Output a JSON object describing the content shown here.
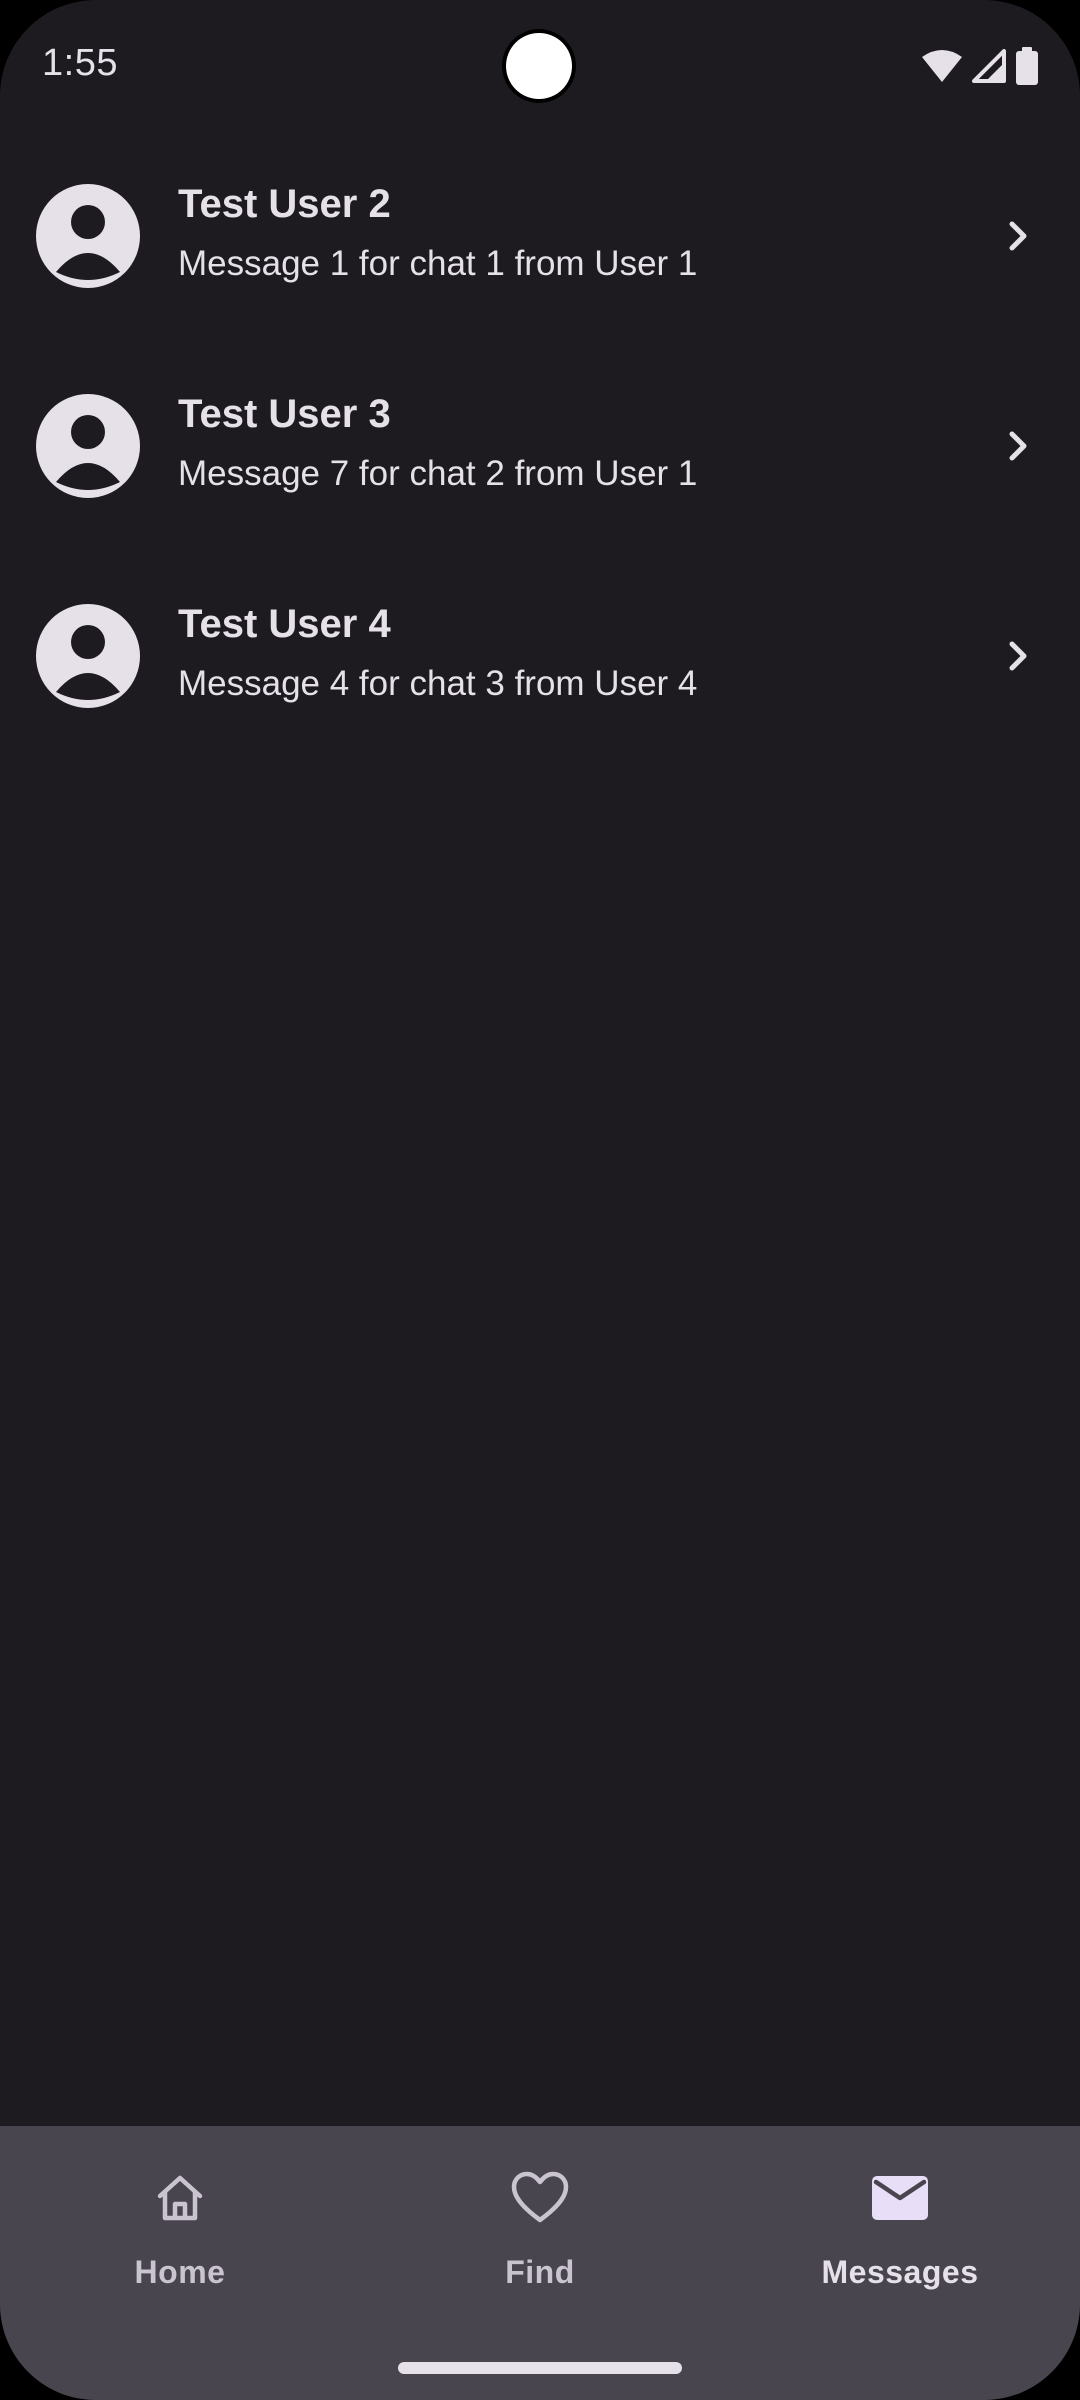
{
  "status_bar": {
    "time": "1:55",
    "icons": [
      "wifi-icon",
      "cellular-signal-icon",
      "battery-icon"
    ]
  },
  "chats": [
    {
      "name": "Test User 2",
      "preview": "Message 1 for chat 1 from User 1",
      "avatar_icon": "person-icon"
    },
    {
      "name": "Test User 3",
      "preview": "Message 7 for chat 2 from User 1",
      "avatar_icon": "person-icon"
    },
    {
      "name": "Test User 4",
      "preview": "Message 4 for chat 3 from User 4",
      "avatar_icon": "person-icon"
    }
  ],
  "bottom_nav": {
    "items": [
      {
        "label": "Home",
        "icon": "home-icon",
        "active": false
      },
      {
        "label": "Find",
        "icon": "heart-icon",
        "active": false
      },
      {
        "label": "Messages",
        "icon": "mail-icon",
        "active": true
      }
    ]
  },
  "colors": {
    "background": "#1d1b20",
    "nav_background": "#49454f",
    "on_surface": "#e6e0e9",
    "nav_inactive": "#cac4d0"
  }
}
